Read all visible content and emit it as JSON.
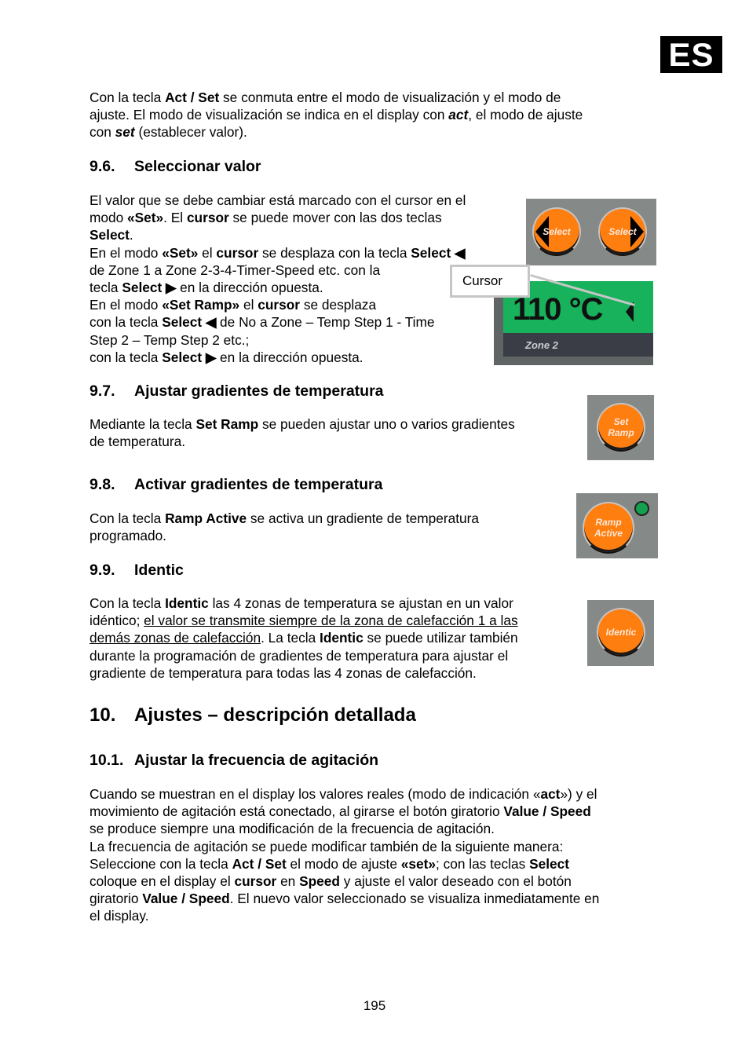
{
  "language_tab": "ES",
  "intro": {
    "l1": [
      "Con la tecla ",
      "Act / Set",
      " se conmuta entre el modo de visualización y el modo de"
    ],
    "l2": [
      "ajuste. El modo de visualización se indica en el display con ",
      "act",
      ", el modo de ajuste"
    ],
    "l3": [
      "con ",
      "set",
      " (establecer valor)."
    ]
  },
  "s96": {
    "num": "9.6.",
    "title": "Seleccionar valor",
    "lines": [
      [
        "El valor que se debe cambiar está marcado con el cursor en el"
      ],
      [
        "modo ",
        "«Set»",
        ". El ",
        "cursor",
        " se puede mover con las dos teclas"
      ],
      [
        "Select",
        "."
      ],
      [
        "En el modo ",
        "«Set»",
        " el ",
        "cursor",
        " se desplaza con la tecla ",
        "Select ◀"
      ],
      [
        "de Zone 1 a Zone 2-3-4-Timer-Speed etc. con la"
      ],
      [
        "tecla ",
        "Select ▶",
        " en la dirección opuesta."
      ],
      [
        "En el modo ",
        "«Set Ramp»",
        " el ",
        "cursor",
        " se desplaza"
      ],
      [
        "con la tecla ",
        "Select ◀",
        " de No a Zone – Temp Step 1 - Time"
      ],
      [
        "Step 2 – Temp Step 2 etc.;"
      ],
      [
        "con la tecla ",
        "Select ▶",
        " en la dirección opuesta."
      ]
    ],
    "figure": {
      "select_left_label": "Select",
      "select_right_label": "Select",
      "cursor_callout": "Cursor",
      "display_value": "110 °C",
      "display_zone": "Zone 2"
    }
  },
  "s97": {
    "num": "9.7.",
    "title": "Ajustar gradientes de temperatura",
    "l1": [
      "Mediante la tecla ",
      "Set Ramp",
      " se pueden ajustar uno o varios gradientes"
    ],
    "l2": "de temperatura.",
    "button_l1": "Set",
    "button_l2": "Ramp"
  },
  "s98": {
    "num": "9.8.",
    "title": "Activar gradientes de temperatura",
    "l1": [
      "Con la tecla ",
      "Ramp Active",
      " se activa un gradiente de temperatura"
    ],
    "l2": "programado.",
    "button_l1": "Ramp",
    "button_l2": "Active"
  },
  "s99": {
    "num": "9.9.",
    "title": "Identic",
    "l1": [
      "Con la tecla ",
      "Identic",
      " las 4 zonas de temperatura se ajustan en un valor"
    ],
    "l2": [
      "idéntico; ",
      "el valor se transmite siempre de la zona de calefacción 1 a las"
    ],
    "l3": [
      "demás zonas de calefacción",
      ". La tecla ",
      "Identic",
      " se puede utilizar también"
    ],
    "l4": "durante la programación de gradientes de temperatura para ajustar el",
    "l5": "gradiente de temperatura para todas las 4 zonas de calefacción.",
    "button": "Identic"
  },
  "s10": {
    "num": "10.",
    "title": "Ajustes – descripción detallada"
  },
  "s101": {
    "num": "10.1.",
    "title": "Ajustar la frecuencia de agitación",
    "lines": [
      [
        "Cuando se muestran en el display los valores reales (modo de indicación «",
        "act",
        "») y el"
      ],
      [
        "movimiento de agitación está conectado, al girarse el botón giratorio ",
        "Value / Speed"
      ],
      [
        "se produce siempre una modificación de la frecuencia de agitación."
      ],
      [
        "La frecuencia de agitación se puede modificar también de la siguiente manera:"
      ],
      [
        "Seleccione con la tecla ",
        "Act / Set",
        " el modo de ajuste ",
        "«set»",
        "; con las teclas ",
        "Select"
      ],
      [
        "coloque en el display el ",
        "cursor",
        " en ",
        "Speed",
        " y ajuste el valor deseado con el botón"
      ],
      [
        "giratorio ",
        "Value / Speed",
        ". El nuevo valor seleccionado se visualiza inmediatamente en"
      ],
      [
        "el display."
      ]
    ]
  },
  "page_number": "195"
}
